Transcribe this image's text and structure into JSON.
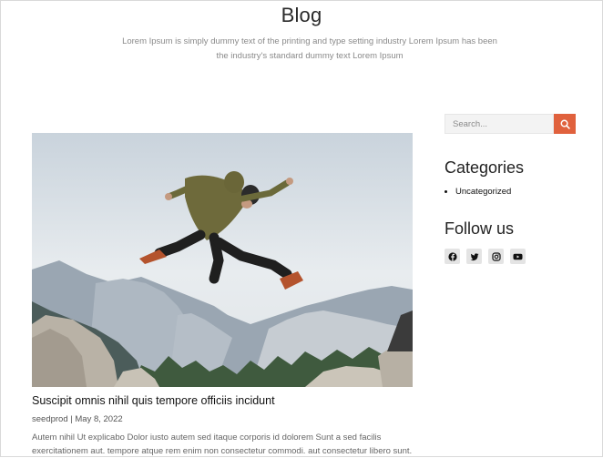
{
  "header": {
    "title": "Blog",
    "subtitle": "Lorem Ipsum is simply dummy text of the printing and type setting industry Lorem Ipsum has been the industry's standard dummy text Lorem Ipsum"
  },
  "post": {
    "image_alt": "man jumping over rocks in mountains",
    "title": "Suscipit omnis nihil quis tempore officiis incidunt",
    "author": "seedprod",
    "separator": "|",
    "date": "May 8, 2022",
    "excerpt": "Autem nihil Ut explicabo Dolor iusto autem sed itaque corporis id dolorem Sunt a sed facilis exercitationem aut. tempore atque rem enim non consectetur commodi. aut consectetur libero sunt."
  },
  "sidebar": {
    "search": {
      "placeholder": "Search...",
      "button_icon": "search-icon"
    },
    "categories": {
      "heading": "Categories",
      "items": [
        "Uncategorized"
      ]
    },
    "follow": {
      "heading": "Follow us",
      "icons": [
        "facebook-icon",
        "twitter-icon",
        "instagram-icon",
        "youtube-icon"
      ]
    }
  },
  "colors": {
    "accent": "#e0613d",
    "icon_bg": "#e4e4e4"
  }
}
